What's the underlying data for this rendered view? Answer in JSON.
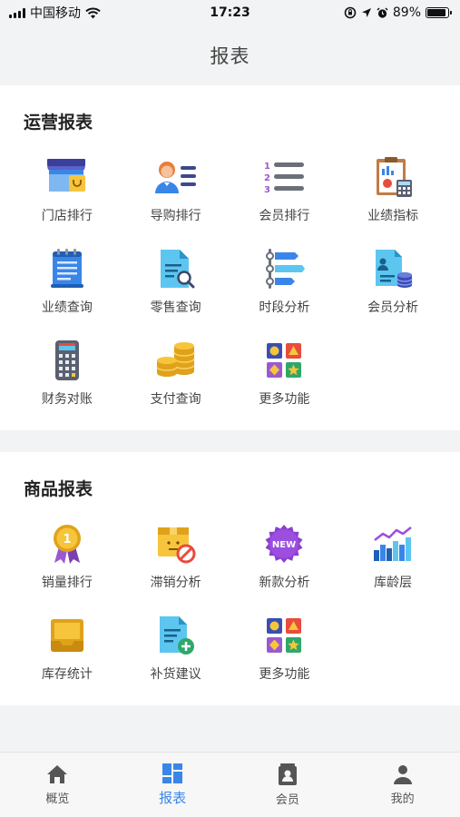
{
  "status_bar": {
    "carrier": "中国移动",
    "time": "17:23",
    "battery": "89%",
    "battery_level": 0.89
  },
  "nav": {
    "title": "报表"
  },
  "operations": {
    "title": "运营报表",
    "items": [
      {
        "label": "门店排行",
        "icon": "store-icon"
      },
      {
        "label": "导购排行",
        "icon": "salesperson-icon"
      },
      {
        "label": "会员排行",
        "icon": "numbered-list-icon"
      },
      {
        "label": "业绩指标",
        "icon": "clipboard-chart-icon"
      },
      {
        "label": "业绩查询",
        "icon": "notepad-icon"
      },
      {
        "label": "零售查询",
        "icon": "document-search-icon"
      },
      {
        "label": "时段分析",
        "icon": "timeline-icon"
      },
      {
        "label": "会员分析",
        "icon": "profile-database-icon"
      },
      {
        "label": "财务对账",
        "icon": "calculator-icon"
      },
      {
        "label": "支付查询",
        "icon": "coins-icon"
      },
      {
        "label": "更多功能",
        "icon": "more-apps-icon"
      }
    ]
  },
  "products": {
    "title": "商品报表",
    "items": [
      {
        "label": "销量排行",
        "icon": "medal-icon",
        "badge": "1"
      },
      {
        "label": "滞销分析",
        "icon": "blocked-box-icon"
      },
      {
        "label": "新款分析",
        "icon": "new-badge-icon",
        "badge": "NEW"
      },
      {
        "label": "库龄层",
        "icon": "bar-trend-icon"
      },
      {
        "label": "库存统计",
        "icon": "inbox-tray-icon"
      },
      {
        "label": "补货建议",
        "icon": "document-add-icon"
      },
      {
        "label": "更多功能",
        "icon": "more-apps-icon"
      }
    ]
  },
  "tab_bar": {
    "tabs": [
      {
        "label": "概览",
        "icon": "home-icon"
      },
      {
        "label": "报表",
        "icon": "dashboard-icon",
        "active": true
      },
      {
        "label": "会员",
        "icon": "member-card-icon"
      },
      {
        "label": "我的",
        "icon": "person-icon"
      }
    ]
  },
  "colors": {
    "accent": "#3a86e8",
    "tab_inactive": "#555555",
    "background": "#f2f3f5"
  }
}
